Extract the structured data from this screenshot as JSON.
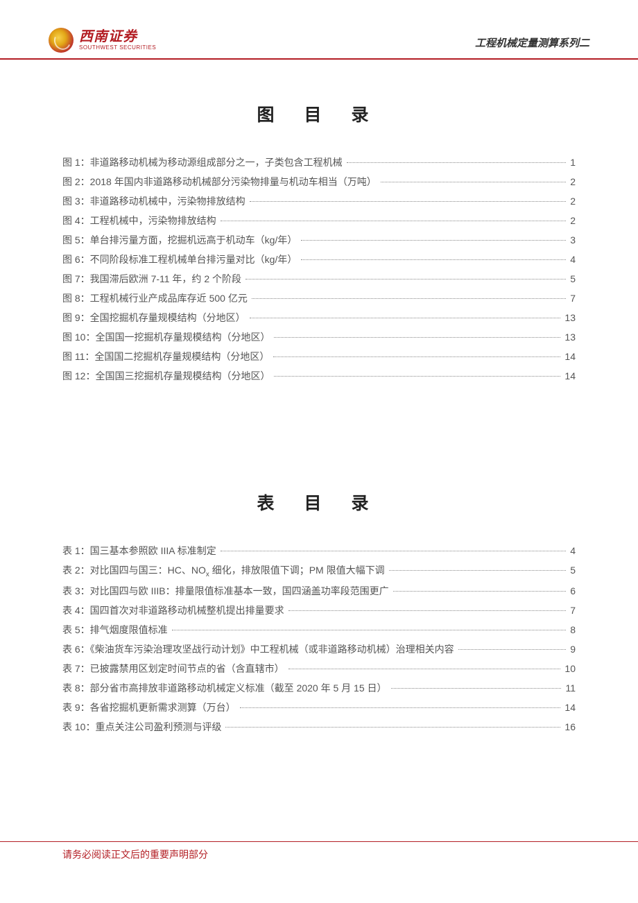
{
  "header": {
    "logo_cn": "西南证券",
    "logo_en": "SOUTHWEST SECURITIES",
    "series": "工程机械定量测算系列二"
  },
  "figures_title": "图 目 录",
  "tables_title": "表 目 录",
  "figures": [
    {
      "label": "图 1：非道路移动机械为移动源组成部分之一，子类包含工程机械",
      "page": "1"
    },
    {
      "label": "图 2：2018 年国内非道路移动机械部分污染物排量与机动车相当（万吨）",
      "page": "2"
    },
    {
      "label": "图 3：非道路移动机械中，污染物排放结构",
      "page": "2"
    },
    {
      "label": "图 4：工程机械中，污染物排放结构",
      "page": "2"
    },
    {
      "label": "图 5：单台排污量方面，挖掘机远高于机动车（kg/年）",
      "page": "3"
    },
    {
      "label": "图 6：不同阶段标准工程机械单台排污量对比（kg/年）",
      "page": "4"
    },
    {
      "label": "图 7：我国滞后欧洲 7-11 年，约 2 个阶段",
      "page": "5"
    },
    {
      "label": "图 8：工程机械行业产成品库存近 500 亿元",
      "page": "7"
    },
    {
      "label": "图 9：全国挖掘机存量规模结构（分地区）",
      "page": "13"
    },
    {
      "label": "图 10：全国国一挖掘机存量规模结构（分地区）",
      "page": "13"
    },
    {
      "label": "图 11：全国国二挖掘机存量规模结构（分地区）",
      "page": "14"
    },
    {
      "label": "图 12：全国国三挖掘机存量规模结构（分地区）",
      "page": "14"
    }
  ],
  "tables": [
    {
      "label": "表 1：国三基本参照欧 IIIA 标准制定",
      "page": "4"
    },
    {
      "label_html": "表 2：对比国四与国三：HC、NO<sub>x</sub> 细化，排放限值下调；PM 限值大幅下调",
      "page": "5"
    },
    {
      "label": "表 3：对比国四与欧 IIIB：排量限值标准基本一致，国四涵盖功率段范围更广",
      "page": "6"
    },
    {
      "label": "表 4：国四首次对非道路移动机械整机提出排量要求",
      "page": "7"
    },
    {
      "label": "表 5：排气烟度限值标准",
      "page": "8"
    },
    {
      "label": "表 6：《柴油货车污染治理攻坚战行动计划》中工程机械（或非道路移动机械）治理相关内容",
      "page": "9"
    },
    {
      "label": "表 7：已披露禁用区划定时间节点的省（含直辖市）",
      "page": "10"
    },
    {
      "label": "表 8：部分省市高排放非道路移动机械定义标准（截至 2020 年 5 月 15 日）",
      "page": "11"
    },
    {
      "label": "表 9：各省挖掘机更新需求测算（万台）",
      "page": "14"
    },
    {
      "label": "表 10：重点关注公司盈利预测与评级",
      "page": "16"
    }
  ],
  "footer": "请务必阅读正文后的重要声明部分"
}
